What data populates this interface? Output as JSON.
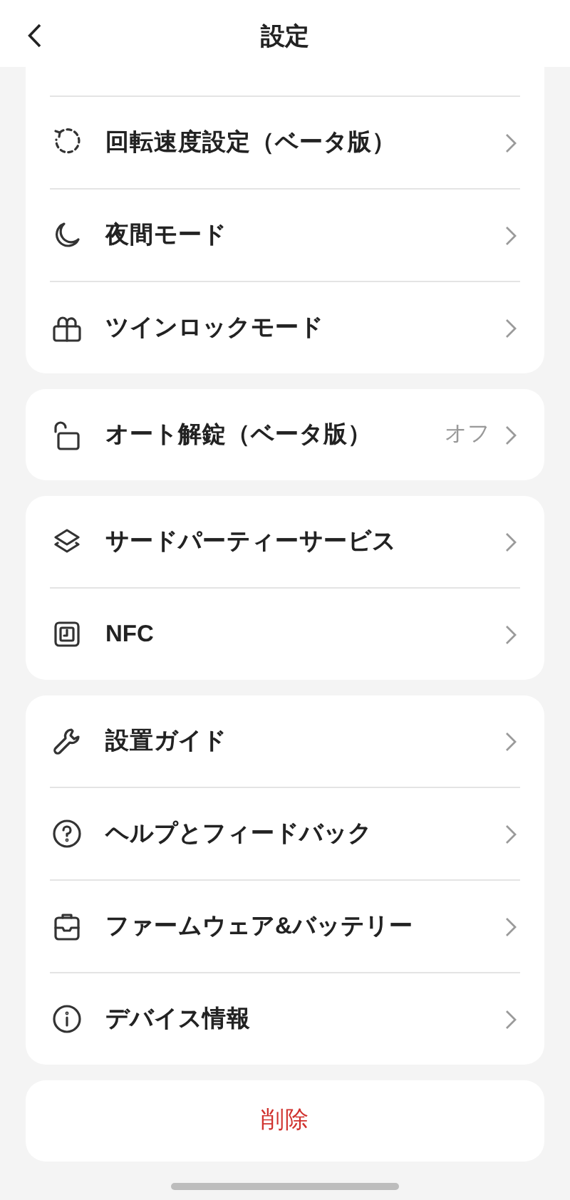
{
  "header": {
    "title": "設定"
  },
  "sections": [
    {
      "items": [
        {
          "label": "回転速度設定（ベータ版）"
        },
        {
          "label": "夜間モード"
        },
        {
          "label": "ツインロックモード"
        }
      ]
    },
    {
      "items": [
        {
          "label": "オート解錠（ベータ版）",
          "value": "オフ"
        }
      ]
    },
    {
      "items": [
        {
          "label": "サードパーティーサービス"
        },
        {
          "label": "NFC"
        }
      ]
    },
    {
      "items": [
        {
          "label": "設置ガイド"
        },
        {
          "label": "ヘルプとフィードバック"
        },
        {
          "label": "ファームウェア&バッテリー"
        },
        {
          "label": "デバイス情報"
        }
      ]
    }
  ],
  "delete_button": {
    "label": "削除"
  }
}
